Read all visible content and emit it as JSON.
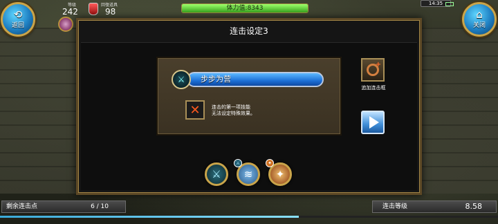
{
  "topbar": {
    "back_label": "返回",
    "close_label": "关闭",
    "level_label": "等级",
    "level_value": "242",
    "potion_label": "回復道具",
    "potion_value": "98",
    "stamina_text": "体力值:8343",
    "stamina_fraction": 1.0,
    "clock": "14:35"
  },
  "dialog": {
    "title": "连击设定3",
    "skill_name": "步步为营",
    "note_line1": "连击的第一项技能",
    "note_line2": "无法设定特殊效果。",
    "add_label": "追加连击框"
  },
  "skills": [
    {
      "icon": "sword-skill-icon"
    },
    {
      "icon": "blue-skill-icon"
    },
    {
      "icon": "flame-skill-icon"
    }
  ],
  "bottom": {
    "points_label": "剩余连击点",
    "points_value": "6 / 10",
    "combo_label": "连击等级",
    "combo_value": "8.58",
    "progress_fraction": 0.6
  },
  "colors": {
    "accent_blue": "#1c6fd6",
    "frame_gold": "#c9a44a",
    "stamina_green": "#3aa51f",
    "x_orange": "#ff5a1e"
  }
}
